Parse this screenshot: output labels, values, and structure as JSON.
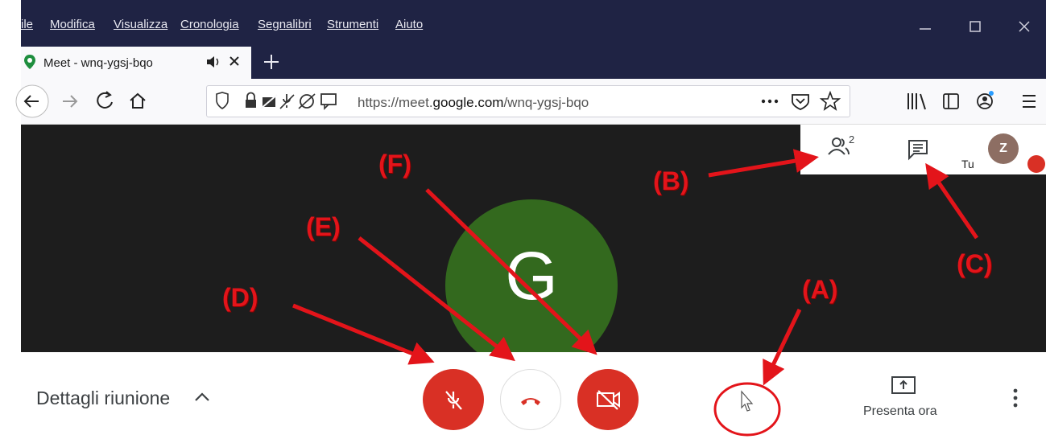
{
  "browser": {
    "menu": [
      "ile",
      "Modifica",
      "Visualizza",
      "Cronologia",
      "Segnalibri",
      "Strumenti",
      "Aiuto"
    ],
    "tab_title": "Meet - wnq-ygsj-bqo",
    "url_prefix": "https://meet.",
    "url_domain": "google.com",
    "url_path": "/wnq-ygsj-bqo"
  },
  "meet": {
    "participant_initial": "G",
    "participants_count": "2",
    "self_label": "Tu",
    "avatar_initial": "Z",
    "meeting_details": "Dettagli riunione",
    "present_now": "Presenta ora"
  },
  "annotations": {
    "A": "(A)",
    "B": "(B)",
    "C": "(C)",
    "D": "(D)",
    "E": "(E)",
    "F": "(F)"
  },
  "colors": {
    "chrome_dark": "#1f2344",
    "meet_red": "#d93025",
    "participant_green": "#33691e",
    "annotation_red": "#e3141a"
  }
}
